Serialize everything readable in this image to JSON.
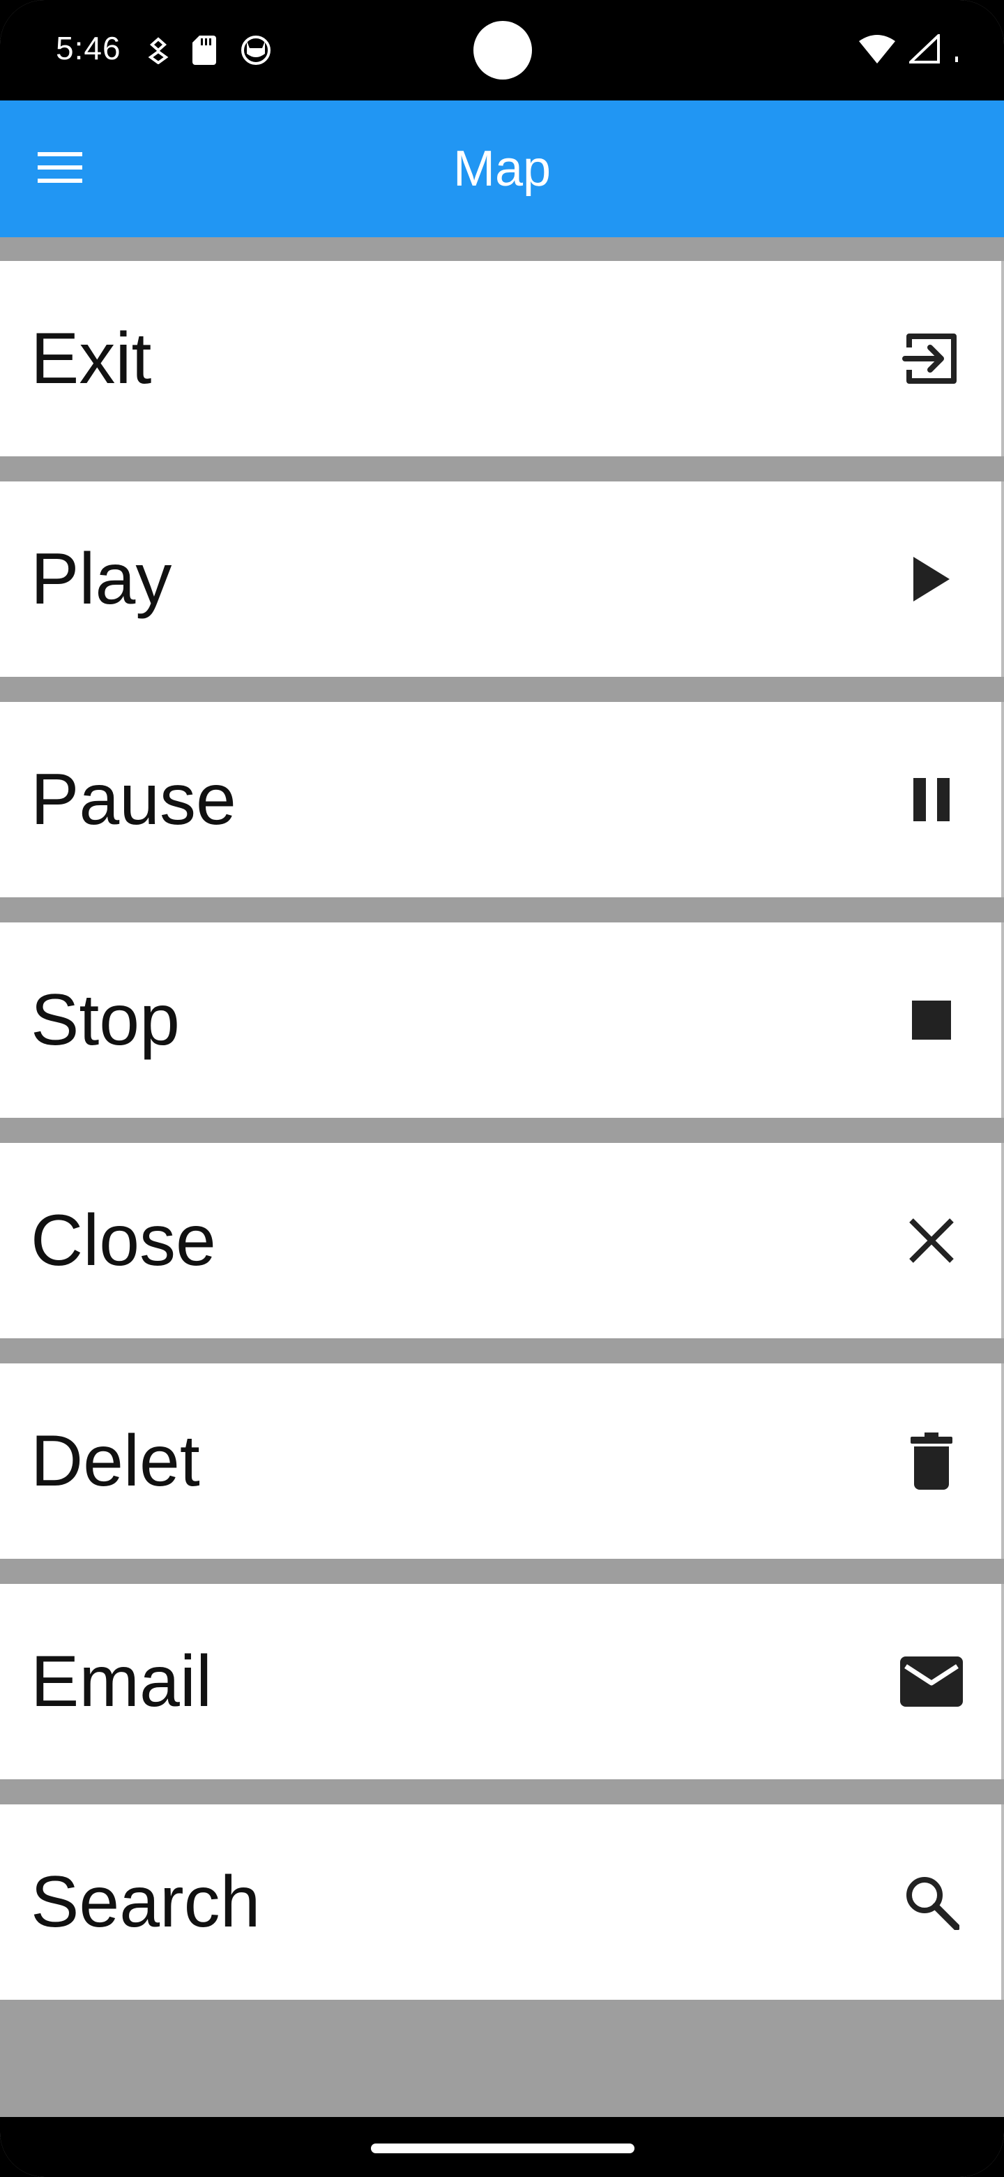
{
  "status_bar": {
    "time": "5:46",
    "left_icons": [
      "health-icon",
      "sd-card-icon",
      "cat-face-icon"
    ],
    "right_icons": [
      "wifi-icon",
      "signal-icon",
      "battery-icon"
    ]
  },
  "app_bar": {
    "title": "Map",
    "menu_icon": "menu-icon",
    "color": "#2196f3"
  },
  "items": [
    {
      "label": "Exit",
      "icon": "exit-icon"
    },
    {
      "label": "Play",
      "icon": "play-icon"
    },
    {
      "label": "Pause",
      "icon": "pause-icon"
    },
    {
      "label": "Stop",
      "icon": "stop-icon"
    },
    {
      "label": "Close",
      "icon": "close-icon"
    },
    {
      "label": "Delet",
      "icon": "delete-icon"
    },
    {
      "label": "Email",
      "icon": "email-icon"
    },
    {
      "label": "Search",
      "icon": "search-icon"
    }
  ]
}
